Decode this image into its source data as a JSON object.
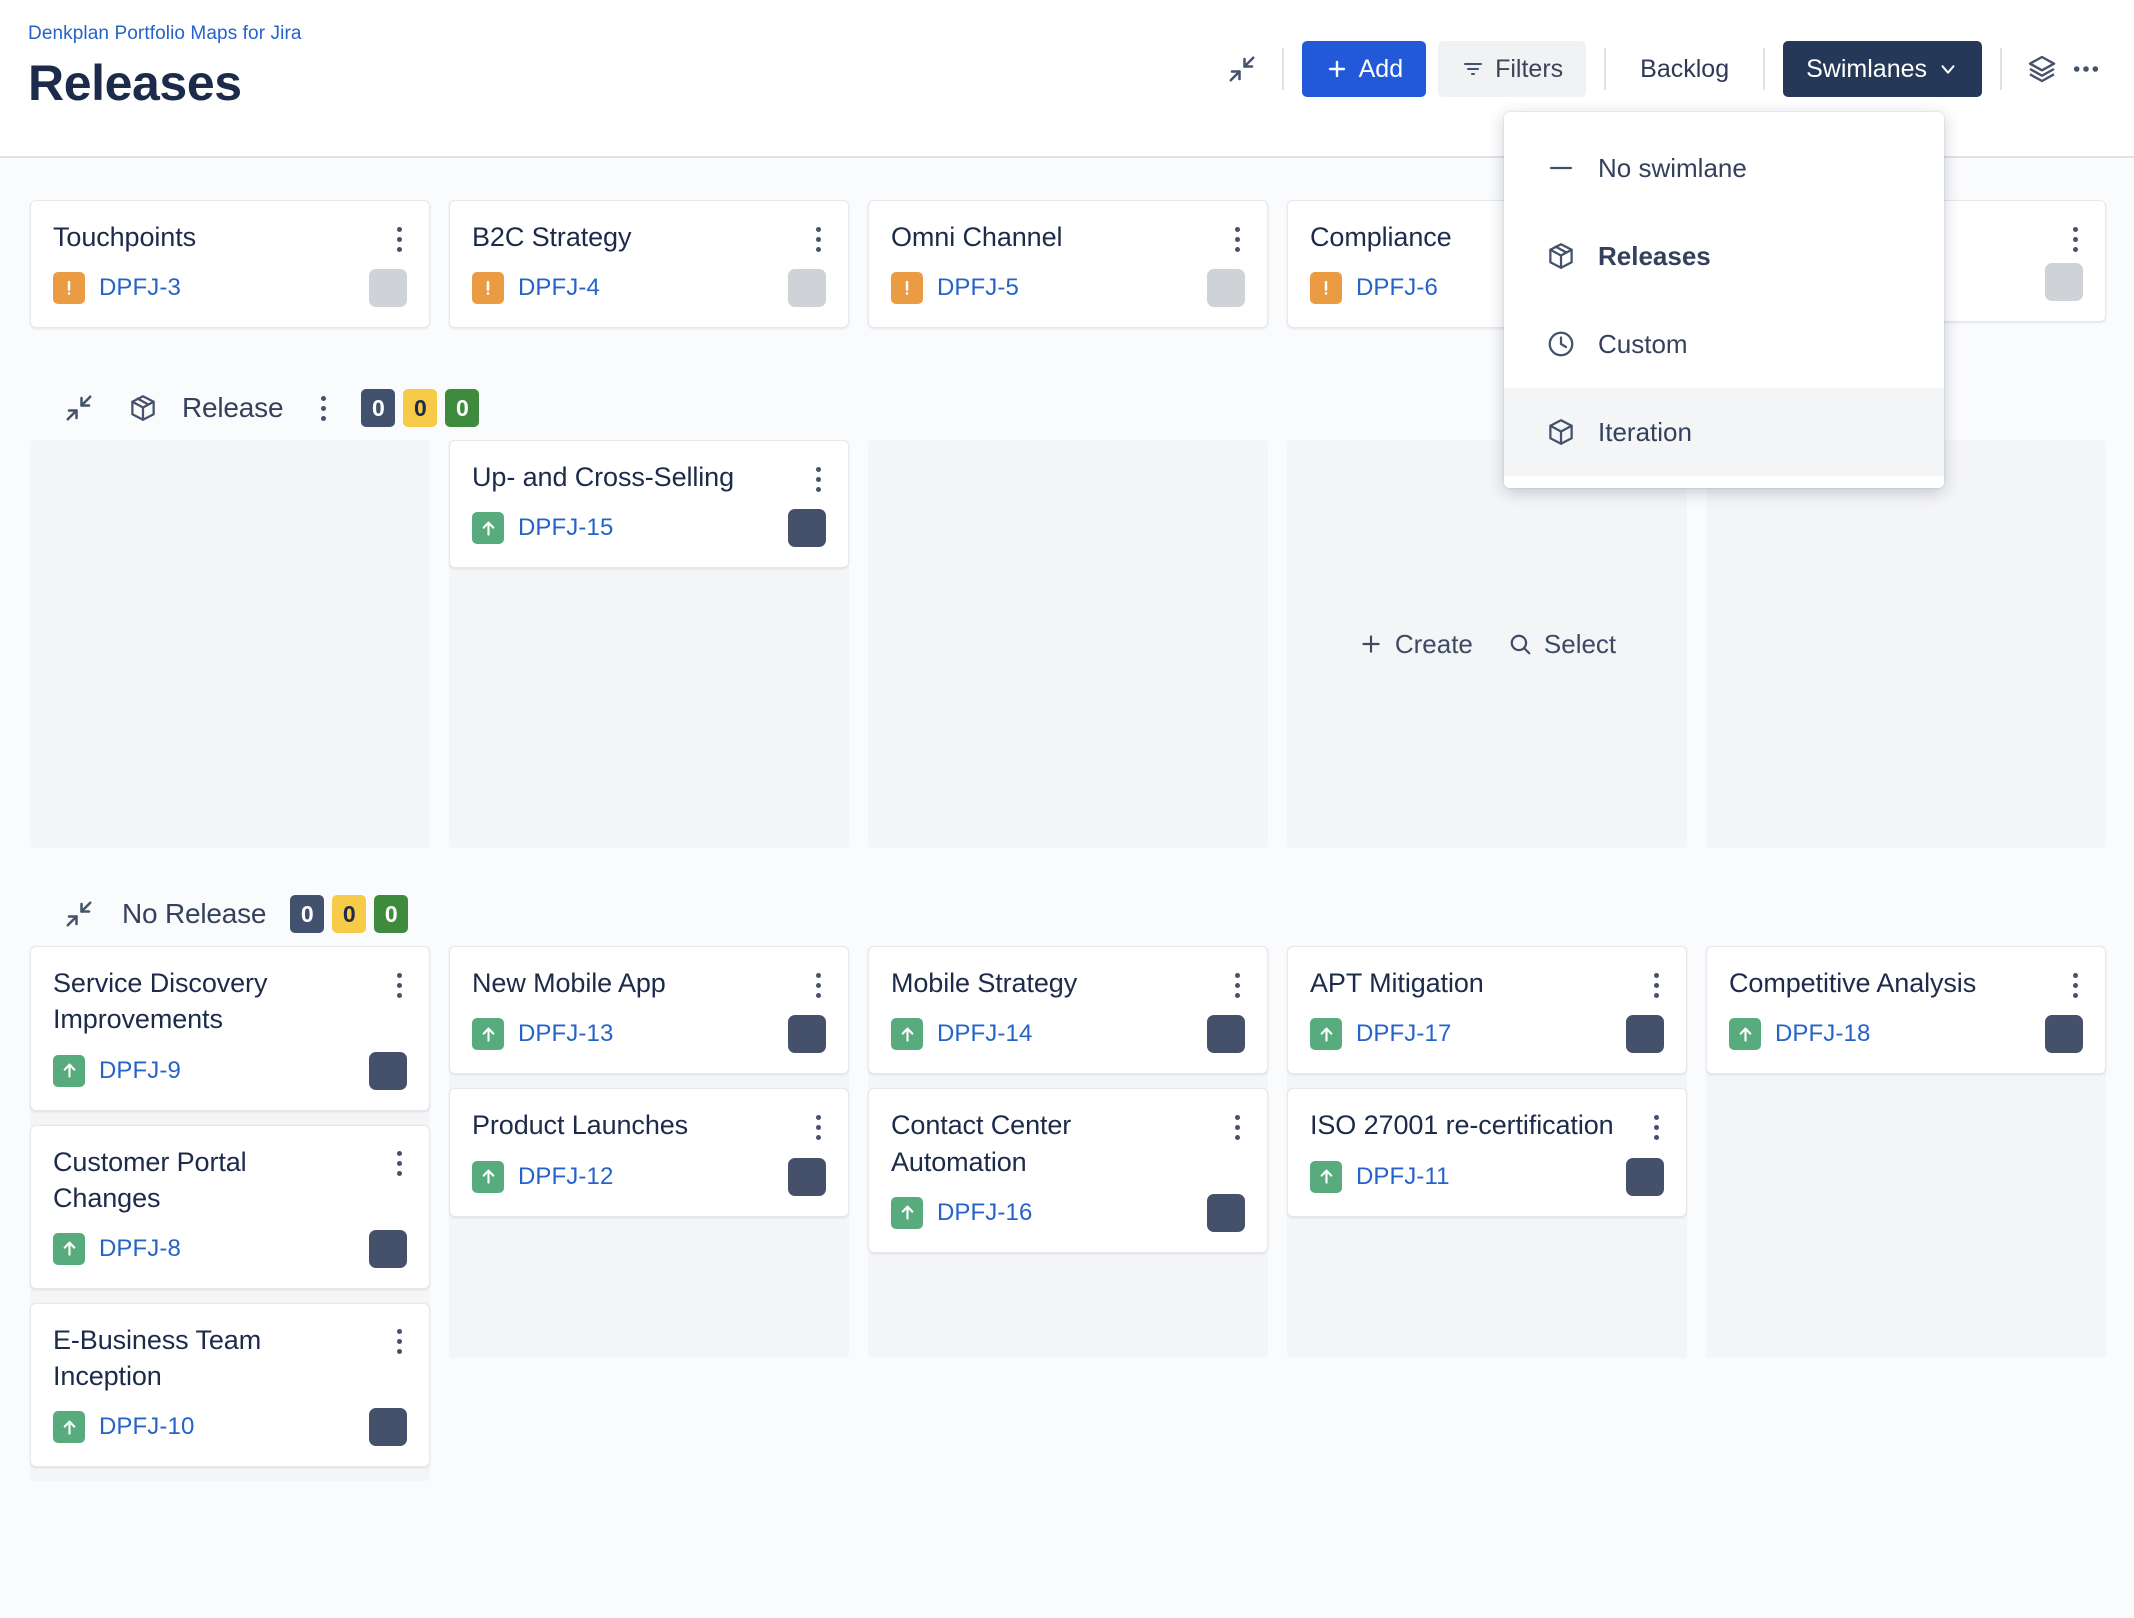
{
  "header": {
    "breadcrumb": "Denkplan Portfolio Maps for Jira",
    "title": "Releases"
  },
  "toolbar": {
    "collapse_icon": "collapse-arrows-icon",
    "add_label": "Add",
    "filters_label": "Filters",
    "backlog_label": "Backlog",
    "swimlanes_label": "Swimlanes",
    "layers_icon": "layers-icon",
    "more_icon": "more-horizontal-icon"
  },
  "swimlane_menu": {
    "items": [
      {
        "label": "No swimlane",
        "icon": "dash-icon",
        "selected": false,
        "hovered": false
      },
      {
        "label": "Releases",
        "icon": "package-icon",
        "selected": true,
        "hovered": false
      },
      {
        "label": "Custom",
        "icon": "clock-icon",
        "selected": false,
        "hovered": false
      },
      {
        "label": "Iteration",
        "icon": "cube-icon",
        "selected": false,
        "hovered": true
      }
    ]
  },
  "board": {
    "top_row": {
      "cards": [
        {
          "title": "Touchpoints",
          "key": "DPFJ-3",
          "type": "epic",
          "avatar": "grey"
        },
        {
          "title": "B2C Strategy",
          "key": "DPFJ-4",
          "type": "epic",
          "avatar": "grey"
        },
        {
          "title": "Omni Channel",
          "key": "DPFJ-5",
          "type": "epic",
          "avatar": "grey"
        },
        {
          "title": "Compliance",
          "key": "DPFJ-6",
          "type": "epic",
          "avatar": "grey"
        },
        {
          "title": "",
          "key": "",
          "type": "hidden",
          "avatar": "grey"
        }
      ]
    },
    "swimlanes": [
      {
        "name": "Release",
        "has_package_icon": true,
        "has_kebab": true,
        "badges": {
          "navy": "0",
          "amber": "0",
          "green": "0"
        },
        "columns": [
          {
            "cards": [],
            "placeholder": false
          },
          {
            "cards": [
              {
                "title": "Up- and Cross-Selling",
                "key": "DPFJ-15",
                "type": "story",
                "avatar": "navy"
              }
            ],
            "placeholder": false
          },
          {
            "cards": [],
            "placeholder": false
          },
          {
            "cards": [],
            "placeholder": true
          },
          {
            "cards": [],
            "placeholder": false
          }
        ]
      },
      {
        "name": "No Release",
        "has_package_icon": false,
        "has_kebab": false,
        "badges": {
          "navy": "0",
          "amber": "0",
          "green": "0"
        },
        "columns": [
          {
            "cards": [
              {
                "title": "Service Discovery Improvements",
                "key": "DPFJ-9",
                "type": "story",
                "avatar": "navy"
              },
              {
                "title": "Customer Portal Changes",
                "key": "DPFJ-8",
                "type": "story",
                "avatar": "navy"
              },
              {
                "title": "E-Business Team Inception",
                "key": "DPFJ-10",
                "type": "story",
                "avatar": "navy"
              }
            ],
            "placeholder": false
          },
          {
            "cards": [
              {
                "title": "New Mobile App",
                "key": "DPFJ-13",
                "type": "story",
                "avatar": "navy"
              },
              {
                "title": "Product Launches",
                "key": "DPFJ-12",
                "type": "story",
                "avatar": "navy"
              }
            ],
            "placeholder": false
          },
          {
            "cards": [
              {
                "title": "Mobile Strategy",
                "key": "DPFJ-14",
                "type": "story",
                "avatar": "navy"
              },
              {
                "title": "Contact Center Automation",
                "key": "DPFJ-16",
                "type": "story",
                "avatar": "navy"
              }
            ],
            "placeholder": false
          },
          {
            "cards": [
              {
                "title": "APT Mitigation",
                "key": "DPFJ-17",
                "type": "story",
                "avatar": "navy"
              },
              {
                "title": "ISO 27001 re-certification",
                "key": "DPFJ-11",
                "type": "story",
                "avatar": "navy"
              }
            ],
            "placeholder": false
          },
          {
            "cards": [
              {
                "title": "Competitive Analysis",
                "key": "DPFJ-18",
                "type": "story",
                "avatar": "navy"
              }
            ],
            "placeholder": false
          }
        ]
      }
    ],
    "placeholder_actions": {
      "create_label": "Create",
      "select_label": "Select"
    }
  },
  "colors": {
    "link": "#2563c9",
    "primary": "#2159d8",
    "dark": "#253858",
    "epic": "#eb9b42",
    "story": "#57ab7d",
    "badge_navy": "#42526e",
    "badge_amber": "#f7cb47",
    "badge_green": "#3e8b3e"
  }
}
